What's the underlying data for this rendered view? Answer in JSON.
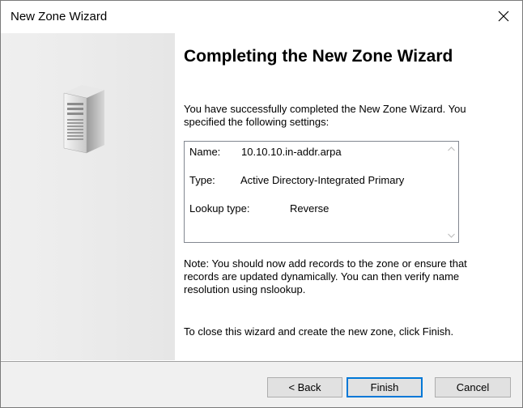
{
  "window": {
    "title": "New Zone Wizard",
    "close_icon": "close-icon"
  },
  "side_panel": {
    "icon": "server-tower-icon"
  },
  "content": {
    "heading": "Completing the New Zone Wizard",
    "intro": "You have successfully completed the New Zone Wizard. You specified the following settings:",
    "settings": [
      {
        "key": "Name:",
        "value": "10.10.10.in-addr.arpa"
      },
      {
        "key": "Type:",
        "value": "Active Directory-Integrated Primary"
      },
      {
        "key": "Lookup type:",
        "value": "Reverse"
      }
    ],
    "note": "Note: You should now add records to the zone or ensure that records are updated dynamically. You can then verify name resolution using nslookup.",
    "close_instructions": "To close this wizard and create the new zone, click Finish."
  },
  "footer": {
    "back_label": "< Back",
    "finish_label": "Finish",
    "cancel_label": "Cancel"
  },
  "colors": {
    "accent": "#0078d7",
    "footer_bg": "#f0f0f0",
    "button_bg": "#e1e1e1"
  }
}
